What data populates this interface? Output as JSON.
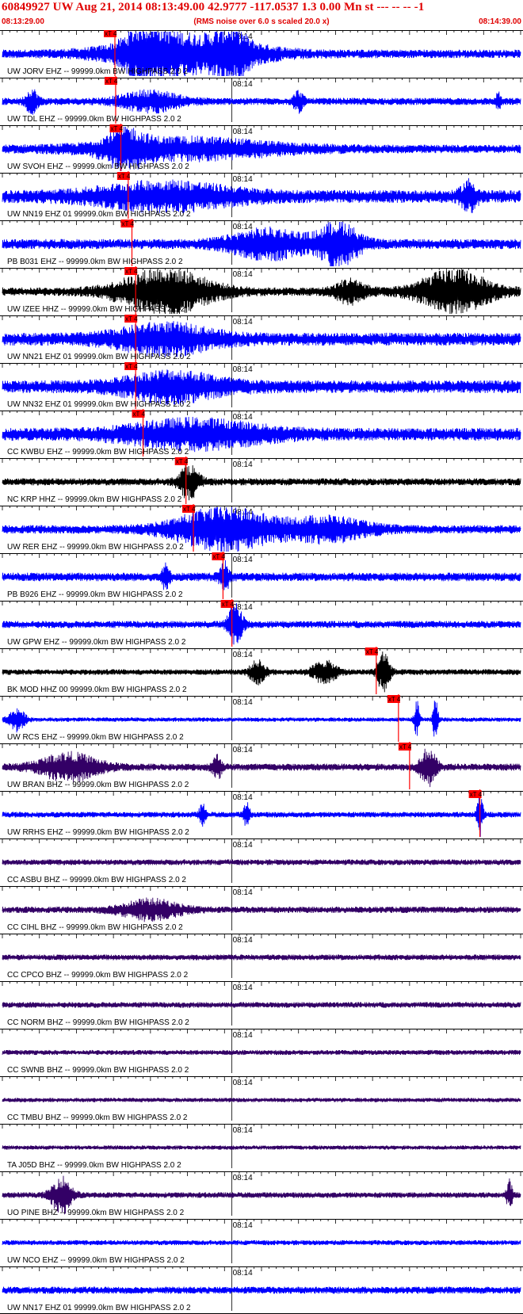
{
  "header": {
    "title": "60849927 UW Aug 21, 2014 08:13:49.00   42.9777 -117.0537  1.3 0.00 Mn st --- -- --  -1",
    "start_time": "08:13:29.00",
    "end_time": "08:14:39.00",
    "note": "(RMS noise over 6.0 s scaled 20.0 x)"
  },
  "chart_data": {
    "type": "line",
    "title": "60849927 UW Aug 21, 2014 08:13:49.00   42.9777 -117.0537  1.3 0.00 Mn st --- -- --  -1",
    "x_range_seconds": [
      0,
      70
    ],
    "start_time": "08:13:29.00",
    "end_time": "08:14:39.00",
    "time_marker": {
      "label": "08:14",
      "t": 31
    },
    "pick_label": "xT 4",
    "traces": [
      {
        "label": "UW JORV EHZ -- 99999.0km BW  HIGHPASS  2.0  2",
        "color": "#0000ff",
        "amp": 0.6,
        "pick": 15.2,
        "bursts": [
          {
            "t": 19.5,
            "w": 2,
            "a": 3
          },
          {
            "t": 25,
            "w": 7,
            "a": 2.5
          },
          {
            "t": 31,
            "w": 1.5,
            "a": 2.2
          }
        ]
      },
      {
        "label": "UW TDL EHZ -- 99999.0km BW  HIGHPASS  2.0  2",
        "color": "#0000ff",
        "amp": 0.5,
        "pick": 15.3,
        "bursts": [
          {
            "t": 4,
            "w": 0.6,
            "a": 1.6
          },
          {
            "t": 20,
            "w": 3,
            "a": 1.3
          },
          {
            "t": 40,
            "w": 0.5,
            "a": 1.3
          },
          {
            "t": 67,
            "w": 0.2,
            "a": 1.5
          }
        ]
      },
      {
        "label": "UW SVOH EHZ -- 99999.0km BW  HIGHPASS  2.0  2",
        "color": "#0000ff",
        "amp": 0.6,
        "pick": 16,
        "bursts": [
          {
            "t": 16.5,
            "w": 2,
            "a": 2
          },
          {
            "t": 25,
            "w": 9,
            "a": 1.3
          }
        ]
      },
      {
        "label": "UW NN19 EHZ 01 99999.0km BW  HIGHPASS  2.0  2",
        "color": "#0000ff",
        "amp": 0.9,
        "pick": 17,
        "bursts": [
          {
            "t": 22,
            "w": 7,
            "a": 1.6
          },
          {
            "t": 63,
            "w": 0.8,
            "a": 1.8
          }
        ]
      },
      {
        "label": "PB B031 EHZ -- 99999.0km BW  HIGHPASS  2.0  2",
        "color": "#0000ff",
        "amp": 0.7,
        "pick": 17.5,
        "bursts": [
          {
            "t": 36,
            "w": 4,
            "a": 1.8
          },
          {
            "t": 45.5,
            "w": 2,
            "a": 2.8
          }
        ]
      },
      {
        "label": "UW IZEE HHZ -- 99999.0km BW  HIGHPASS  2.0  2",
        "color": "#000000",
        "amp": 0.6,
        "pick": 18,
        "bursts": [
          {
            "t": 22,
            "w": 4.5,
            "a": 3
          },
          {
            "t": 47,
            "w": 1.5,
            "a": 1.5
          },
          {
            "t": 61,
            "w": 3.5,
            "a": 2.8
          }
        ]
      },
      {
        "label": "UW NN21 EHZ 01 99999.0km BW  HIGHPASS  2.0  2",
        "color": "#0000ff",
        "amp": 0.9,
        "pick": 18,
        "bursts": [
          {
            "t": 22,
            "w": 5,
            "a": 1.7
          }
        ]
      },
      {
        "label": "UW NN32 EHZ 01 99999.0km BW  HIGHPASS  2.0  2",
        "color": "#0000ff",
        "amp": 0.9,
        "pick": 18,
        "bursts": [
          {
            "t": 23,
            "w": 5,
            "a": 1.7
          }
        ]
      },
      {
        "label": "CC KWBU EHZ -- 99999.0km BW  HIGHPASS  2.0  2",
        "color": "#0000ff",
        "amp": 0.9,
        "pick": 19,
        "bursts": [
          {
            "t": 26,
            "w": 7,
            "a": 1.6
          }
        ]
      },
      {
        "label": "NC KRP HHZ -- 99999.0km BW  HIGHPASS  2.0  2",
        "color": "#000000",
        "amp": 0.5,
        "pick": 24.8,
        "bursts": [
          {
            "t": 25.2,
            "w": 1,
            "a": 2.2
          }
        ]
      },
      {
        "label": "UW RER EHZ -- 99999.0km BW  HIGHPASS  2.0  2",
        "color": "#0000ff",
        "amp": 0.6,
        "pick": 25.8,
        "bursts": [
          {
            "t": 30,
            "w": 5,
            "a": 2.8
          },
          {
            "t": 44,
            "w": 4,
            "a": 1.5
          }
        ]
      },
      {
        "label": "PB B926 EHZ -- 99999.0km BW  HIGHPASS  2.0  2",
        "color": "#0000ff",
        "amp": 0.6,
        "pick": 29.8,
        "bursts": [
          {
            "t": 22,
            "w": 0.4,
            "a": 1.5
          },
          {
            "t": 30,
            "w": 0.5,
            "a": 1.8
          }
        ]
      },
      {
        "label": "UW GPW EHZ -- 99999.0km BW  HIGHPASS  2.0  2",
        "color": "#0000ff",
        "amp": 0.5,
        "pick": 31,
        "bursts": [
          {
            "t": 31.5,
            "w": 0.7,
            "a": 3
          }
        ]
      },
      {
        "label": "BK MOD HHZ 00 99999.0km BW  HIGHPASS  2.0  2",
        "color": "#000000",
        "amp": 0.4,
        "pick": 50.5,
        "bursts": [
          {
            "t": 34.5,
            "w": 0.8,
            "a": 1.5
          },
          {
            "t": 43.5,
            "w": 1.2,
            "a": 1.5
          },
          {
            "t": 51.5,
            "w": 0.6,
            "a": 3
          }
        ]
      },
      {
        "label": "UW RCS EHZ -- 99999.0km BW  HIGHPASS  2.0  2",
        "color": "#0000ff",
        "amp": 0.3,
        "pick": 53.5,
        "bursts": [
          {
            "t": 2,
            "w": 0.8,
            "a": 1.5
          },
          {
            "t": 56,
            "w": 0.25,
            "a": 2.5
          },
          {
            "t": 58.5,
            "w": 0.25,
            "a": 3
          }
        ]
      },
      {
        "label": "UW BRAN BHZ -- 99999.0km BW  HIGHPASS  2.0  2",
        "color": "#330066",
        "amp": 0.5,
        "pick": 55,
        "bursts": [
          {
            "t": 9,
            "w": 3,
            "a": 1.8
          },
          {
            "t": 29,
            "w": 0.5,
            "a": 1.5
          },
          {
            "t": 57.5,
            "w": 0.8,
            "a": 2.5
          }
        ]
      },
      {
        "label": "UW RRHS EHZ -- 99999.0km BW  HIGHPASS  2.0  2",
        "color": "#0000ff",
        "amp": 0.4,
        "pick": 64.5,
        "bursts": [
          {
            "t": 27,
            "w": 0.3,
            "a": 1.5
          },
          {
            "t": 33,
            "w": 0.3,
            "a": 1.6
          },
          {
            "t": 64.5,
            "w": 0.3,
            "a": 3
          }
        ]
      },
      {
        "label": "CC ASBU BHZ -- 99999.0km BW  HIGHPASS  2.0  2",
        "color": "#330066",
        "amp": 0.4,
        "pick": null,
        "bursts": []
      },
      {
        "label": "CC CIHL BHZ -- 99999.0km BW  HIGHPASS  2.0  2",
        "color": "#330066",
        "amp": 0.45,
        "pick": null,
        "bursts": [
          {
            "t": 20,
            "w": 3,
            "a": 1.3
          }
        ]
      },
      {
        "label": "CC CPCO BHZ -- 99999.0km BW  HIGHPASS  2.0  2",
        "color": "#330066",
        "amp": 0.4,
        "pick": null,
        "bursts": []
      },
      {
        "label": "CC NORM BHZ -- 99999.0km BW  HIGHPASS  2.0  2",
        "color": "#330066",
        "amp": 0.4,
        "pick": null,
        "bursts": []
      },
      {
        "label": "CC SWNB BHZ -- 99999.0km BW  HIGHPASS  2.0  2",
        "color": "#330066",
        "amp": 0.35,
        "pick": null,
        "bursts": []
      },
      {
        "label": "CC TMBU BHZ -- 99999.0km BW  HIGHPASS  2.0  2",
        "color": "#330066",
        "amp": 0.3,
        "pick": null,
        "bursts": []
      },
      {
        "label": "TA J05D BHZ -- 99999.0km BW  HIGHPASS  2.0  2",
        "color": "#330066",
        "amp": 0.3,
        "pick": null,
        "bursts": []
      },
      {
        "label": "UO PINE BHZ -- 99999.0km BW  HIGHPASS  2.0  2",
        "color": "#330066",
        "amp": 0.4,
        "pick": null,
        "bursts": [
          {
            "t": 8,
            "w": 1,
            "a": 2.5
          },
          {
            "t": 68.5,
            "w": 0.3,
            "a": 2
          }
        ]
      },
      {
        "label": "UW NCO EHZ -- 99999.0km BW  HIGHPASS  2.0  2",
        "color": "#0000ff",
        "amp": 0.35,
        "pick": null,
        "bursts": []
      },
      {
        "label": "UW NN17 EHZ 01 99999.0km BW  HIGHPASS  2.0  2",
        "color": "#0000ff",
        "amp": 0.5,
        "pick": null,
        "bursts": []
      }
    ]
  }
}
